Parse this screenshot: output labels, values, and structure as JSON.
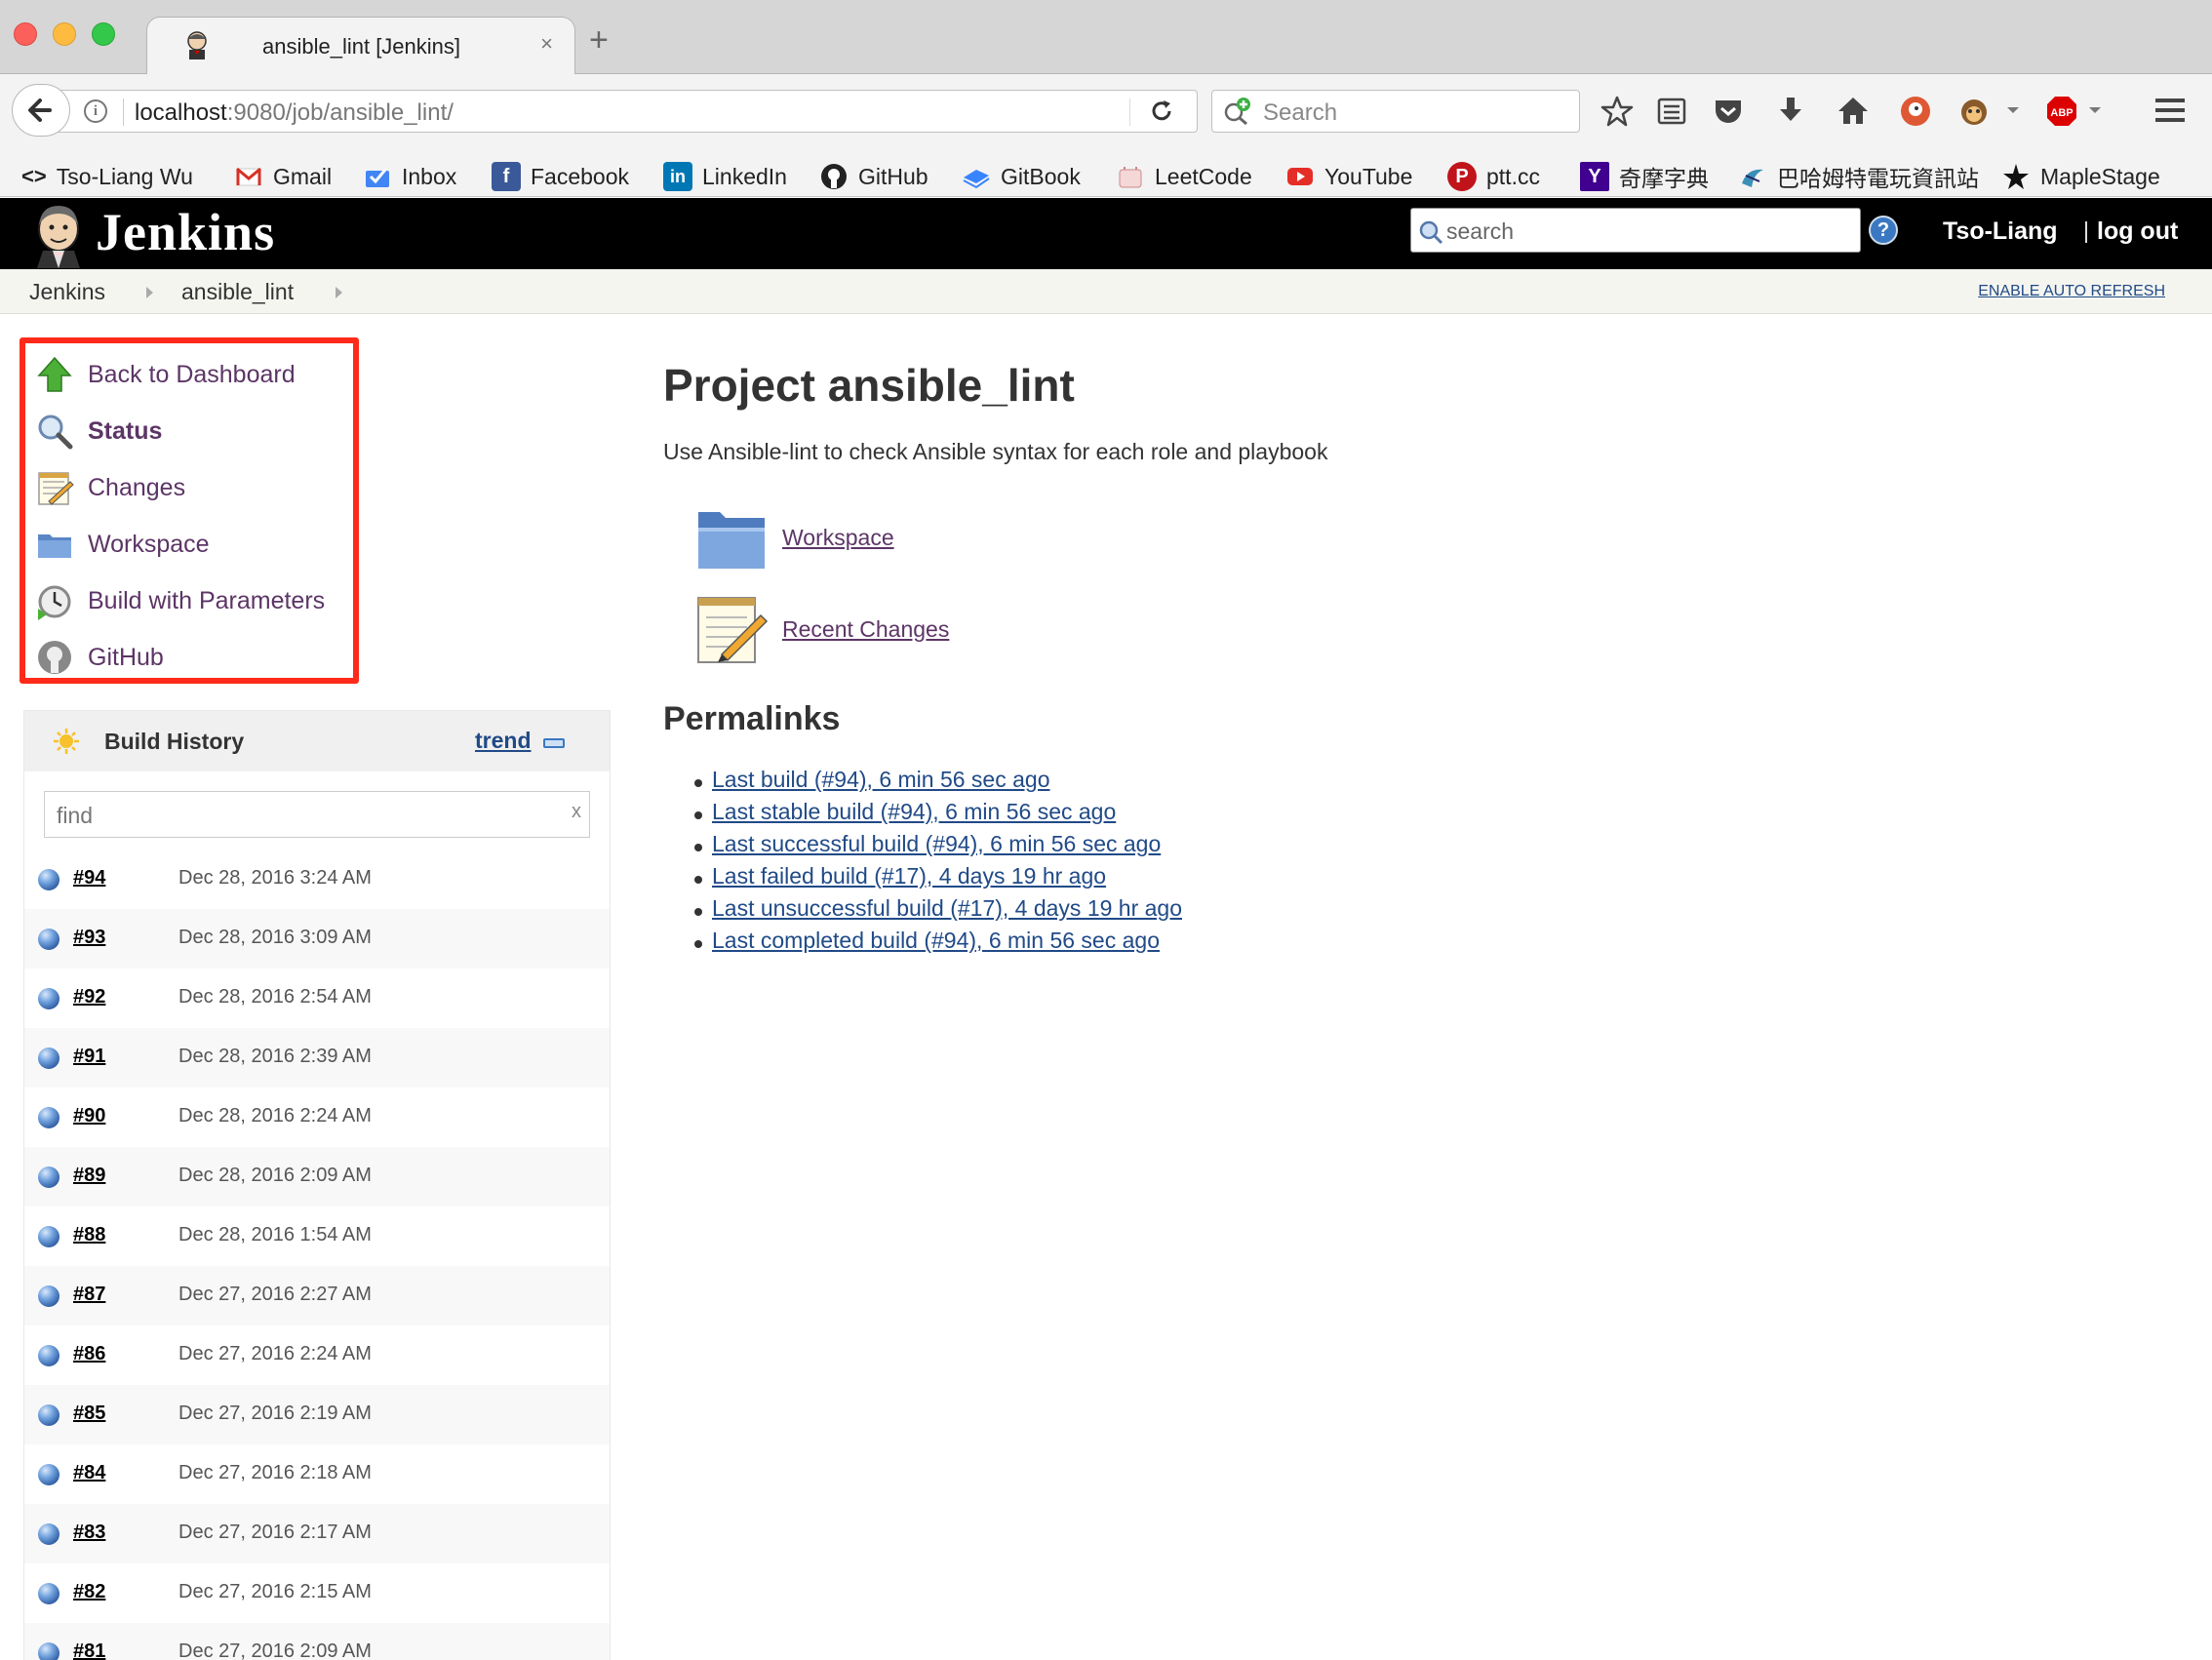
{
  "browser": {
    "tab_title": "ansible_lint [Jenkins]",
    "tab_close": "×",
    "new_tab": "+",
    "url_host": "localhost",
    "url_rest": ":9080/job/ansible_lint/",
    "search_placeholder": "Search",
    "info_glyph": "i"
  },
  "bookmarks": [
    {
      "label": "Tso-Liang Wu",
      "icon": "code-icon"
    },
    {
      "label": "Gmail",
      "icon": "gmail-icon"
    },
    {
      "label": "Inbox",
      "icon": "inbox-icon"
    },
    {
      "label": "Facebook",
      "icon": "facebook-icon"
    },
    {
      "label": "LinkedIn",
      "icon": "linkedin-icon"
    },
    {
      "label": "GitHub",
      "icon": "github-icon"
    },
    {
      "label": "GitBook",
      "icon": "gitbook-icon"
    },
    {
      "label": "LeetCode",
      "icon": "leetcode-icon"
    },
    {
      "label": "YouTube",
      "icon": "youtube-icon"
    },
    {
      "label": "ptt.cc",
      "icon": "ptt-icon"
    },
    {
      "label": "奇摩字典",
      "icon": "yahoo-icon"
    },
    {
      "label": "巴哈姆特電玩資訊站",
      "icon": "bahamut-icon"
    },
    {
      "label": "MapleStage",
      "icon": "star-icon"
    }
  ],
  "jenkins": {
    "title": "Jenkins",
    "search_placeholder": "search",
    "help_glyph": "?",
    "user": "Tso-Liang",
    "logout": "log out"
  },
  "breadcrumbs": {
    "items": [
      "Jenkins",
      "ansible_lint"
    ],
    "auto_refresh": "ENABLE AUTO REFRESH"
  },
  "tasks": [
    {
      "label": "Back to Dashboard",
      "icon": "up-arrow-icon"
    },
    {
      "label": "Status",
      "icon": "magnifier-icon"
    },
    {
      "label": "Changes",
      "icon": "notepad-icon"
    },
    {
      "label": "Workspace",
      "icon": "folder-icon"
    },
    {
      "label": "Build with Parameters",
      "icon": "clock-icon"
    },
    {
      "label": "GitHub",
      "icon": "github-icon"
    }
  ],
  "build_history": {
    "title": "Build History",
    "trend": "trend",
    "find_placeholder": "find",
    "clear": "x",
    "builds": [
      {
        "num": "#94",
        "date": "Dec 28, 2016 3:24 AM"
      },
      {
        "num": "#93",
        "date": "Dec 28, 2016 3:09 AM"
      },
      {
        "num": "#92",
        "date": "Dec 28, 2016 2:54 AM"
      },
      {
        "num": "#91",
        "date": "Dec 28, 2016 2:39 AM"
      },
      {
        "num": "#90",
        "date": "Dec 28, 2016 2:24 AM"
      },
      {
        "num": "#89",
        "date": "Dec 28, 2016 2:09 AM"
      },
      {
        "num": "#88",
        "date": "Dec 28, 2016 1:54 AM"
      },
      {
        "num": "#87",
        "date": "Dec 27, 2016 2:27 AM"
      },
      {
        "num": "#86",
        "date": "Dec 27, 2016 2:24 AM"
      },
      {
        "num": "#85",
        "date": "Dec 27, 2016 2:19 AM"
      },
      {
        "num": "#84",
        "date": "Dec 27, 2016 2:18 AM"
      },
      {
        "num": "#83",
        "date": "Dec 27, 2016 2:17 AM"
      },
      {
        "num": "#82",
        "date": "Dec 27, 2016 2:15 AM"
      },
      {
        "num": "#81",
        "date": "Dec 27, 2016 2:09 AM"
      }
    ]
  },
  "main": {
    "title": "Project ansible_lint",
    "description": "Use Ansible-lint to check Ansible syntax for each role and playbook",
    "links": [
      {
        "label": "Workspace",
        "icon": "folder-icon"
      },
      {
        "label": "Recent Changes",
        "icon": "notepad-icon"
      }
    ],
    "permalinks_title": "Permalinks",
    "permalinks": [
      "Last build (#94), 6 min 56 sec ago",
      "Last stable build (#94), 6 min 56 sec ago",
      "Last successful build (#94), 6 min 56 sec ago",
      "Last failed build (#17), 4 days 19 hr ago",
      "Last unsuccessful build (#17), 4 days 19 hr ago",
      "Last completed build (#94), 6 min 56 sec ago"
    ]
  },
  "colors": {
    "highlight_border": "#ff2a1a",
    "link_visited": "#5c3566",
    "link": "#204a87",
    "header_bg": "#000000"
  }
}
